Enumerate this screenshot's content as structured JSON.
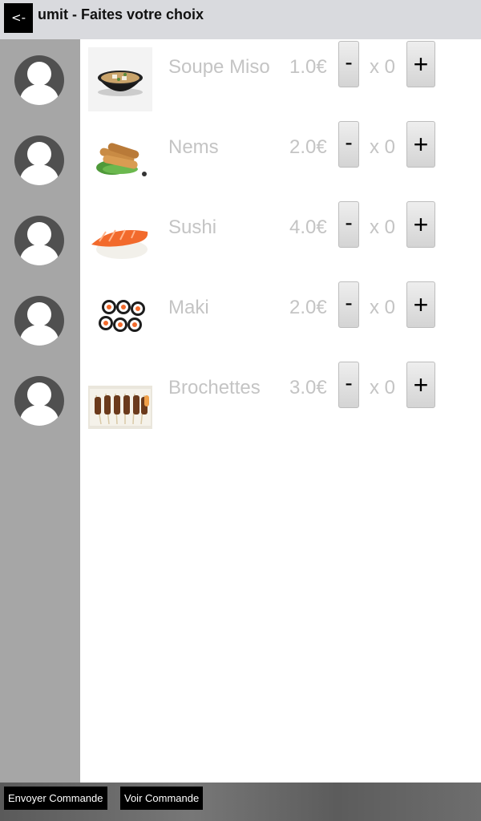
{
  "header": {
    "back_label": "<-",
    "title": "umit - Faites votre choix"
  },
  "sidebar": {
    "avatars": [
      "avatar",
      "avatar",
      "avatar",
      "avatar",
      "avatar"
    ]
  },
  "menu": {
    "items": [
      {
        "name": "Soupe Miso",
        "price": "1.0€",
        "minus": "-",
        "qty": "x 0",
        "plus": "+"
      },
      {
        "name": "Nems",
        "price": "2.0€",
        "minus": "-",
        "qty": "x 0",
        "plus": "+"
      },
      {
        "name": "Sushi",
        "price": "4.0€",
        "minus": "-",
        "qty": "x 0",
        "plus": "+"
      },
      {
        "name": "Maki",
        "price": "2.0€",
        "minus": "-",
        "qty": "x 0",
        "plus": "+"
      },
      {
        "name": "Brochettes",
        "price": "3.0€",
        "minus": "-",
        "qty": "x 0",
        "plus": "+"
      }
    ]
  },
  "footer": {
    "send_label": "Envoyer Commande",
    "view_label": "Voir Commande"
  },
  "colors": {
    "header_bg": "#d9dade",
    "sidebar_bg": "#a6a6a6",
    "muted_text": "#c4c4c4",
    "button_dark": "#000000"
  }
}
